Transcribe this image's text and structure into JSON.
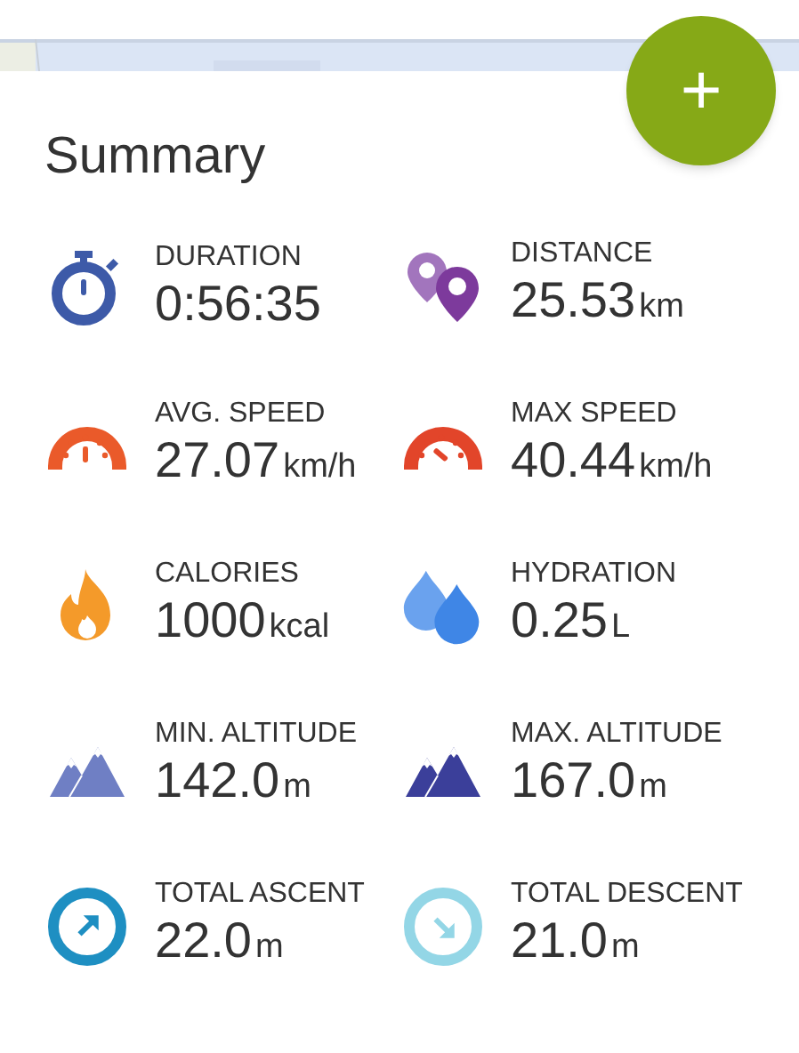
{
  "add_button": {
    "label": "+"
  },
  "title": "Summary",
  "stats": [
    {
      "kind": "stopwatch",
      "color": "#3d5aa8",
      "label": "DURATION",
      "value": "0:56:35"
    },
    {
      "kind": "pins",
      "color": "#7d3a9c",
      "label": "DISTANCE",
      "value": "25.53",
      "unit": "km"
    },
    {
      "kind": "gauge",
      "color": "#ea5a2a",
      "label": "AVG. SPEED",
      "value": "27.07",
      "unit": "km/h"
    },
    {
      "kind": "gauge-high",
      "color": "#e2452a",
      "label": "MAX SPEED",
      "value": "40.44",
      "unit": "km/h"
    },
    {
      "kind": "flame",
      "color": "#f49a2a",
      "label": "CALORIES",
      "value": "1000",
      "unit": "kcal"
    },
    {
      "kind": "drops",
      "color": "#3f86e6",
      "label": "HYDRATION",
      "value": "0.25",
      "unit": "L"
    },
    {
      "kind": "mountains",
      "color": "#6f7fc4",
      "label": "MIN. ALTITUDE",
      "value": "142.0",
      "unit": "m"
    },
    {
      "kind": "mountains",
      "color": "#3b3f9a",
      "label": "MAX. ALTITUDE",
      "value": "167.0",
      "unit": "m"
    },
    {
      "kind": "ascent",
      "color": "#1e8fc2",
      "label": "TOTAL ASCENT",
      "value": "22.0",
      "unit": "m"
    },
    {
      "kind": "descent",
      "color": "#93d6e6",
      "label": "TOTAL DESCENT",
      "value": "21.0",
      "unit": "m"
    }
  ]
}
